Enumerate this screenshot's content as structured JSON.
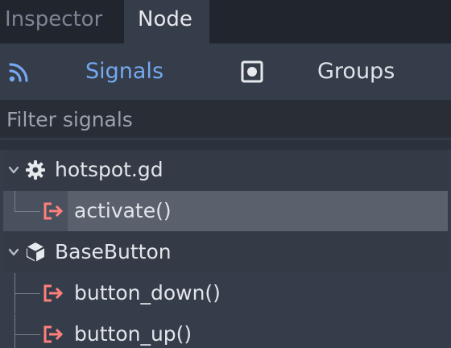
{
  "tabs": {
    "inspector_label": "Inspector",
    "node_label": "Node"
  },
  "modes": {
    "signals_label": "Signals",
    "groups_label": "Groups",
    "signals_icon": "signal-icon",
    "groups_icon": "groups-icon"
  },
  "filter": {
    "placeholder": "Filter signals",
    "value": ""
  },
  "tree": {
    "sections": [
      {
        "label": "hotspot.gd",
        "icon": "gear-icon",
        "items": [
          {
            "label": "activate()",
            "selected": true
          }
        ]
      },
      {
        "label": "BaseButton",
        "icon": "cube-icon",
        "items": [
          {
            "label": "button_down()"
          },
          {
            "label": "button_up()"
          }
        ]
      }
    ]
  },
  "colors": {
    "accent": "#75a8f0",
    "signal": "#ff7f7a",
    "text": "#e2e6eb",
    "muted": "#9aa2ae",
    "background": "#363d4a"
  }
}
